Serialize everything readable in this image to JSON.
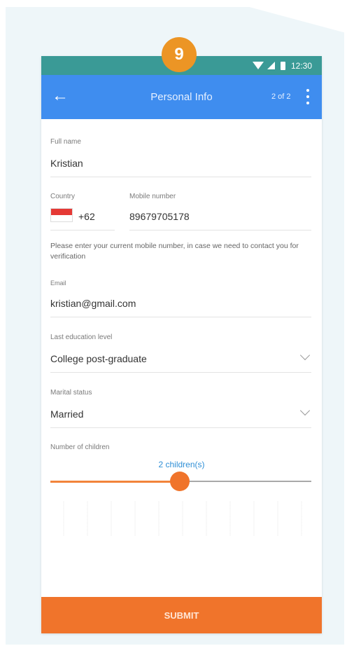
{
  "step_badge": "9",
  "status_bar": {
    "time": "12:30"
  },
  "app_bar": {
    "title": "Personal Info",
    "page_indicator": "2 of 2"
  },
  "form": {
    "full_name": {
      "label": "Full name",
      "value": "Kristian"
    },
    "country": {
      "label": "Country",
      "dial_code": "+62",
      "flag": "indonesia-flag-icon"
    },
    "mobile": {
      "label": "Mobile number",
      "value": "89679705178"
    },
    "mobile_helper": "Please enter your current mobile number, in case we need to contact you for verification",
    "email": {
      "label": "Email",
      "value": "kristian@gmail.com"
    },
    "education": {
      "label": "Last education level",
      "value": "College post-graduate"
    },
    "marital": {
      "label": "Marital status",
      "value": "Married"
    },
    "children": {
      "label": "Number of children",
      "value_text": "2 children(s)",
      "slider_fraction": 0.5
    }
  },
  "submit_label": "SUBMIT",
  "colors": {
    "status_bar": "#3a9a96",
    "app_bar": "#3f8def",
    "accent": "#f0742b",
    "badge": "#ec9525",
    "slider_value_text": "#2f8fd6"
  }
}
